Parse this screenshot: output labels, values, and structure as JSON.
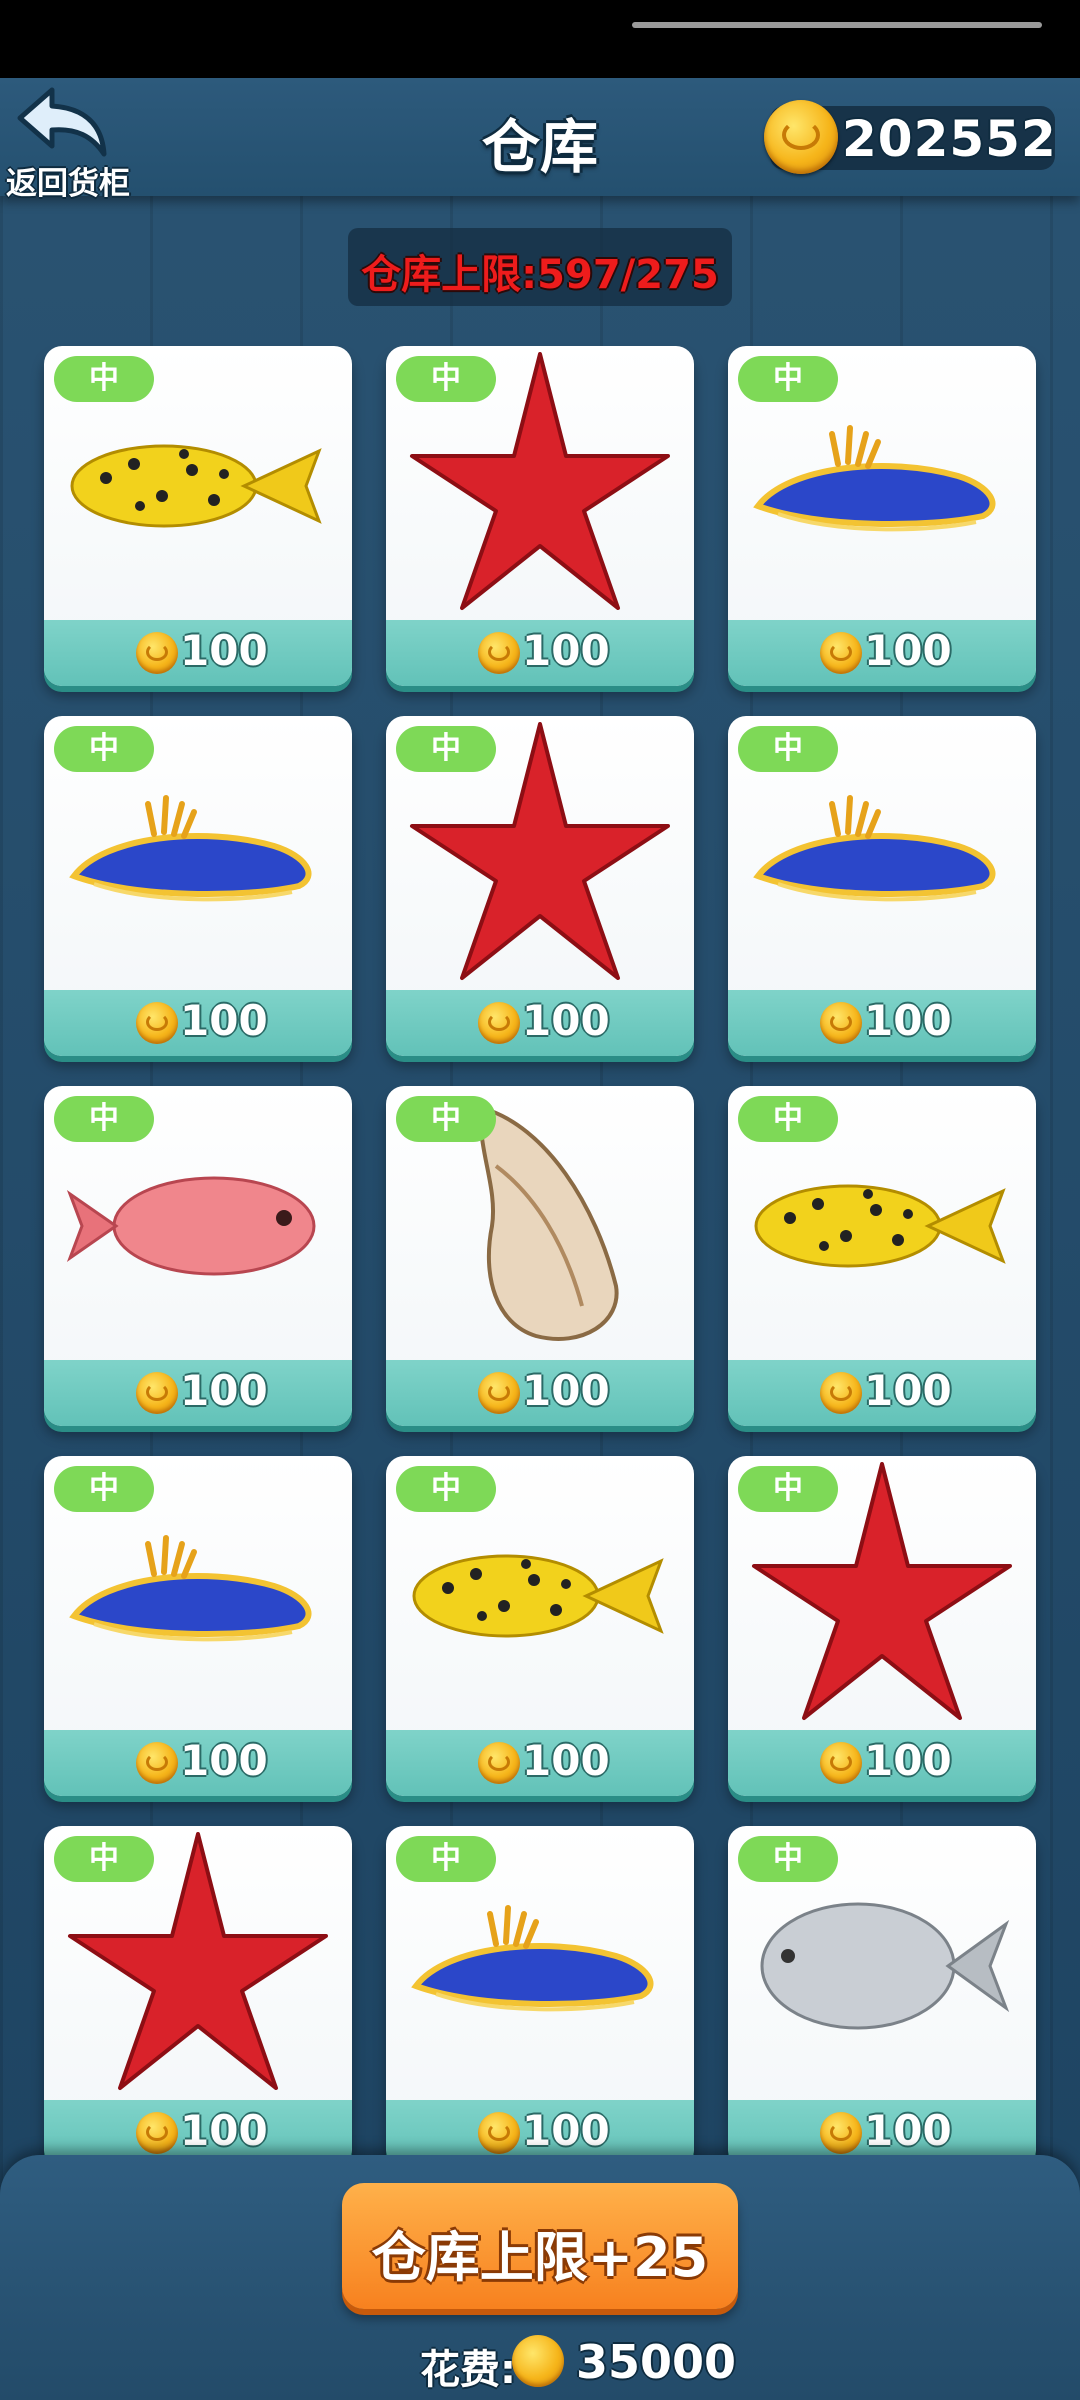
{
  "header": {
    "back_label": "返回货柜",
    "title": "仓库",
    "coins": "202552"
  },
  "capacity": {
    "text": "仓库上限:597/275"
  },
  "items": [
    {
      "grade": "中",
      "price": "100",
      "icon": "boxfish-icon"
    },
    {
      "grade": "中",
      "price": "100",
      "icon": "starfish-icon"
    },
    {
      "grade": "中",
      "price": "100",
      "icon": "sea-slug-icon"
    },
    {
      "grade": "中",
      "price": "100",
      "icon": "sea-slug-icon"
    },
    {
      "grade": "中",
      "price": "100",
      "icon": "starfish-icon"
    },
    {
      "grade": "中",
      "price": "100",
      "icon": "sea-slug-icon"
    },
    {
      "grade": "中",
      "price": "100",
      "icon": "red-snapper-icon"
    },
    {
      "grade": "中",
      "price": "100",
      "icon": "conch-shell-icon"
    },
    {
      "grade": "中",
      "price": "100",
      "icon": "boxfish-icon"
    },
    {
      "grade": "中",
      "price": "100",
      "icon": "sea-slug-icon"
    },
    {
      "grade": "中",
      "price": "100",
      "icon": "boxfish-icon"
    },
    {
      "grade": "中",
      "price": "100",
      "icon": "starfish-icon"
    },
    {
      "grade": "中",
      "price": "100",
      "icon": "starfish-icon"
    },
    {
      "grade": "中",
      "price": "100",
      "icon": "sea-slug-icon"
    },
    {
      "grade": "中",
      "price": "100",
      "icon": "pomfret-icon"
    }
  ],
  "footer": {
    "upgrade_label": "仓库上限+25",
    "cost_label": "花费:",
    "cost_value": "35000"
  },
  "colors": {
    "background": "#1f4360",
    "badge": "#7ed957",
    "price_strip": "#6ac7bd",
    "capacity_text": "#ee1c1c",
    "upgrade_button": "#f7811f"
  }
}
